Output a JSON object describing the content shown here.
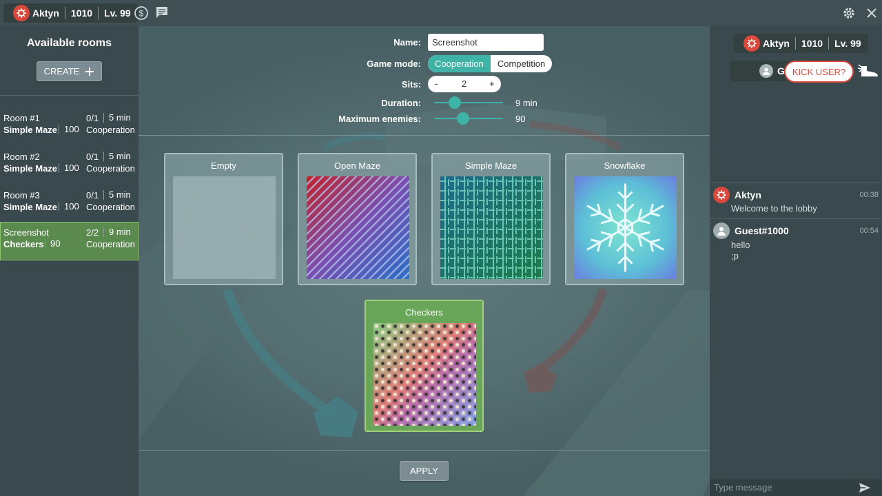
{
  "topbar": {
    "user": {
      "name": "Aktyn",
      "score": "1010",
      "level": "Lv. 99"
    }
  },
  "sidebar": {
    "title": "Available rooms",
    "create_label": "CREATE",
    "rooms": [
      {
        "name": "Room #1",
        "map": "Simple Maze",
        "enemies": "100",
        "sits": "0/1",
        "duration": "5 min",
        "mode": "Cooperation"
      },
      {
        "name": "Room #2",
        "map": "Simple Maze",
        "enemies": "100",
        "sits": "0/1",
        "duration": "5 min",
        "mode": "Cooperation"
      },
      {
        "name": "Room #3",
        "map": "Simple Maze",
        "enemies": "100",
        "sits": "0/1",
        "duration": "5 min",
        "mode": "Cooperation"
      },
      {
        "name": "Screenshot",
        "map": "Checkers",
        "enemies": "90",
        "sits": "2/2",
        "duration": "9 min",
        "mode": "Cooperation"
      }
    ]
  },
  "settings": {
    "name_label": "Name:",
    "name_value": "Screenshot",
    "mode_label": "Game mode:",
    "mode_options": [
      "Cooperation",
      "Competition"
    ],
    "sits_label": "Sits:",
    "sits_minus": "-",
    "sits_value": "2",
    "sits_plus": "+",
    "duration_label": "Duration:",
    "duration_value": "9 min",
    "duration_fraction": 0.3,
    "enemies_label": "Maximum enemies:",
    "enemies_value": "90",
    "enemies_fraction": 0.42
  },
  "maps": [
    {
      "title": "Empty"
    },
    {
      "title": "Open Maze"
    },
    {
      "title": "Simple Maze"
    },
    {
      "title": "Snowflake"
    },
    {
      "title": "Checkers"
    }
  ],
  "apply_label": "APPLY",
  "right": {
    "user": {
      "name": "Aktyn",
      "score": "1010",
      "level": "Lv. 99"
    },
    "guest_initial": "G",
    "kick_label": "KICK USER?",
    "messages": [
      {
        "author": "Aktyn",
        "time": "00:38",
        "lines": [
          "Welcome to the lobby"
        ]
      },
      {
        "author": "Guest#1000",
        "time": "00:54",
        "lines": [
          "hello",
          ";p"
        ]
      }
    ],
    "chat_placeholder": "Type message"
  },
  "colors": {
    "accent": "#3fb3a6",
    "danger": "#d9483b",
    "selected": "#6aa659"
  }
}
